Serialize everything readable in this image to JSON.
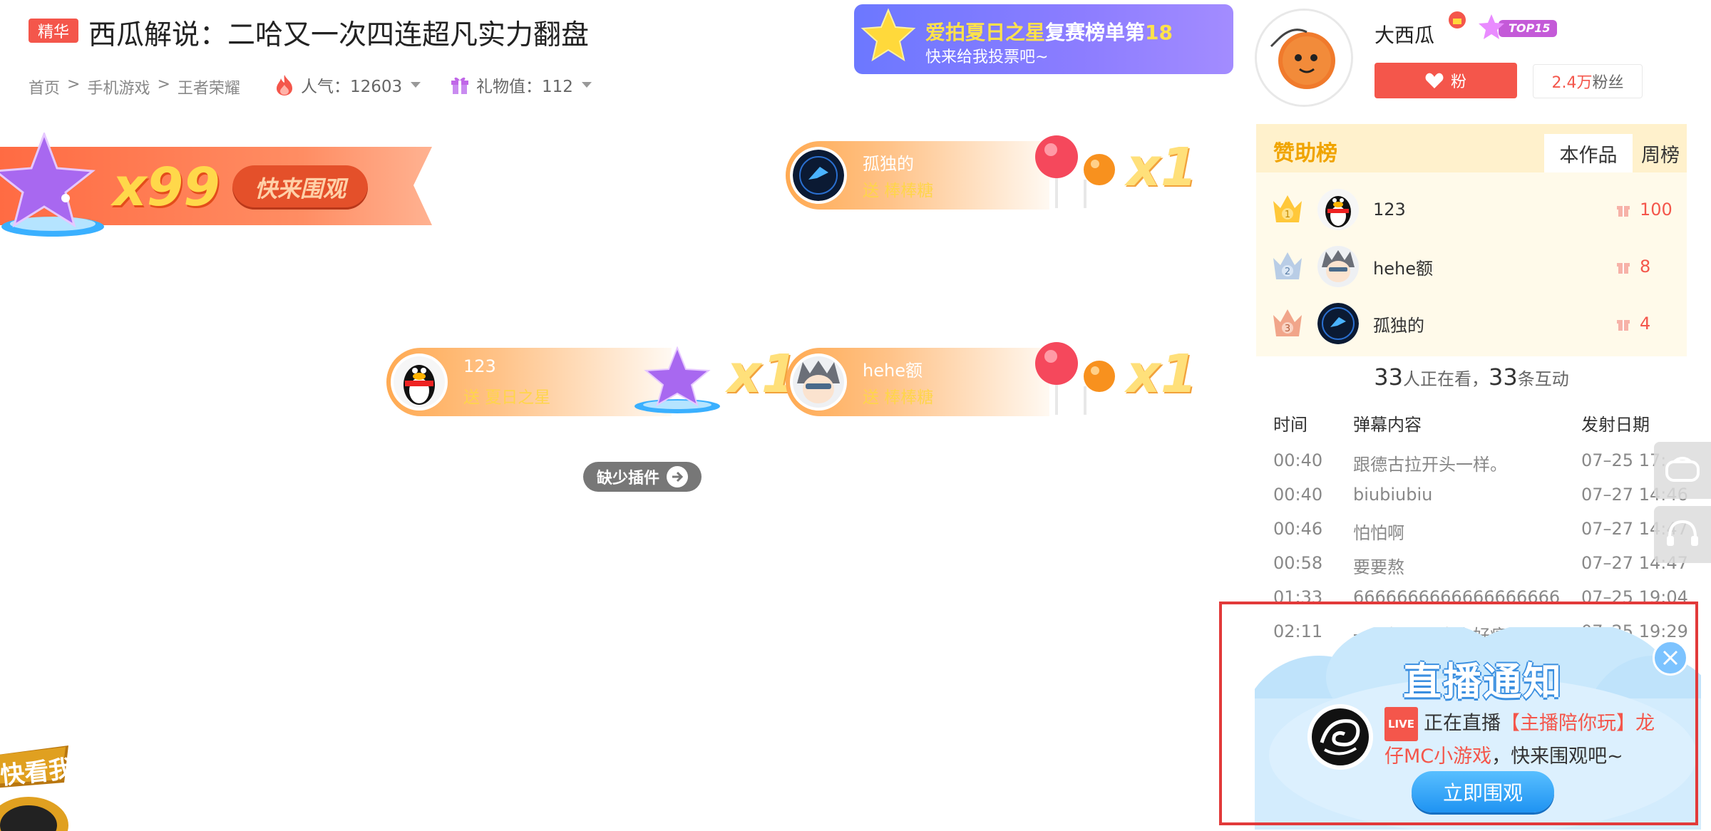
{
  "header": {
    "badge": "精华",
    "title": "西瓜解说：二哈又一次四连超凡实力翻盘",
    "breadcrumb": [
      "首页",
      ">",
      "手机游戏",
      ">",
      "王者荣耀"
    ],
    "popularity": "人气：12603",
    "gift_value": "礼物值：112"
  },
  "promo": {
    "line1_highlight": "爱拍夏日之星",
    "line1_rest": "复赛榜单第",
    "line1_rank": "18",
    "line2": "快来给我投票吧~"
  },
  "anchor": {
    "name": "大西瓜",
    "badge": "TOP15",
    "fan_button": "粉",
    "fans": "2.4万",
    "fans_suffix": "粉丝"
  },
  "sponsor": {
    "title": "赞助榜",
    "tabs": [
      "本作品",
      "周榜"
    ],
    "rows": [
      {
        "rank": "1",
        "name": "123",
        "value": "100"
      },
      {
        "rank": "2",
        "name": "hehe额",
        "value": "8"
      },
      {
        "rank": "3",
        "name": "孤独的",
        "value": "4"
      }
    ]
  },
  "stats": {
    "watching": "33",
    "watching_label": "人正在看，",
    "interactions": "33",
    "interactions_label": "条互动"
  },
  "danmaku": {
    "headers": [
      "时间",
      "弹幕内容",
      "发射日期"
    ],
    "rows": [
      [
        "00:40",
        "跟德古拉开头一样。",
        "07–25  17:"
      ],
      [
        "00:40",
        "biubiubiu",
        "07–27  14:46"
      ],
      [
        "00:46",
        "怕怕啊",
        "07–27  14:47"
      ],
      [
        "00:58",
        "要要熬",
        "07–27  14:47"
      ],
      [
        "01:33",
        "6666666666666666666",
        "07–25  19:04"
      ],
      [
        "02:11",
        "一下打到人身上好痛",
        "07–25  19:29"
      ]
    ]
  },
  "banner_x99": {
    "count": "x99",
    "button": "快来围观"
  },
  "gifts": [
    {
      "name": "孤独的",
      "action": "送 棒棒糖",
      "mult": "x1"
    },
    {
      "name": "123",
      "action": "送 夏日之星",
      "mult": "x1"
    },
    {
      "name": "hehe额",
      "action": "送 棒棒糖",
      "mult": "x1"
    }
  ],
  "plugin": {
    "label": "缺少插件"
  },
  "corner": {
    "text": "快看我"
  },
  "notice": {
    "title": "直播通知",
    "live_tag": "LIVE",
    "prefix": "正在直播",
    "room": "【主播陪你玩】龙仔MC小游戏",
    "suffix": "，快来围观吧~",
    "button": "立即围观"
  },
  "colors": {
    "accent": "#f4564b",
    "gold": "#f0a400",
    "blue": "#1f93f2"
  }
}
